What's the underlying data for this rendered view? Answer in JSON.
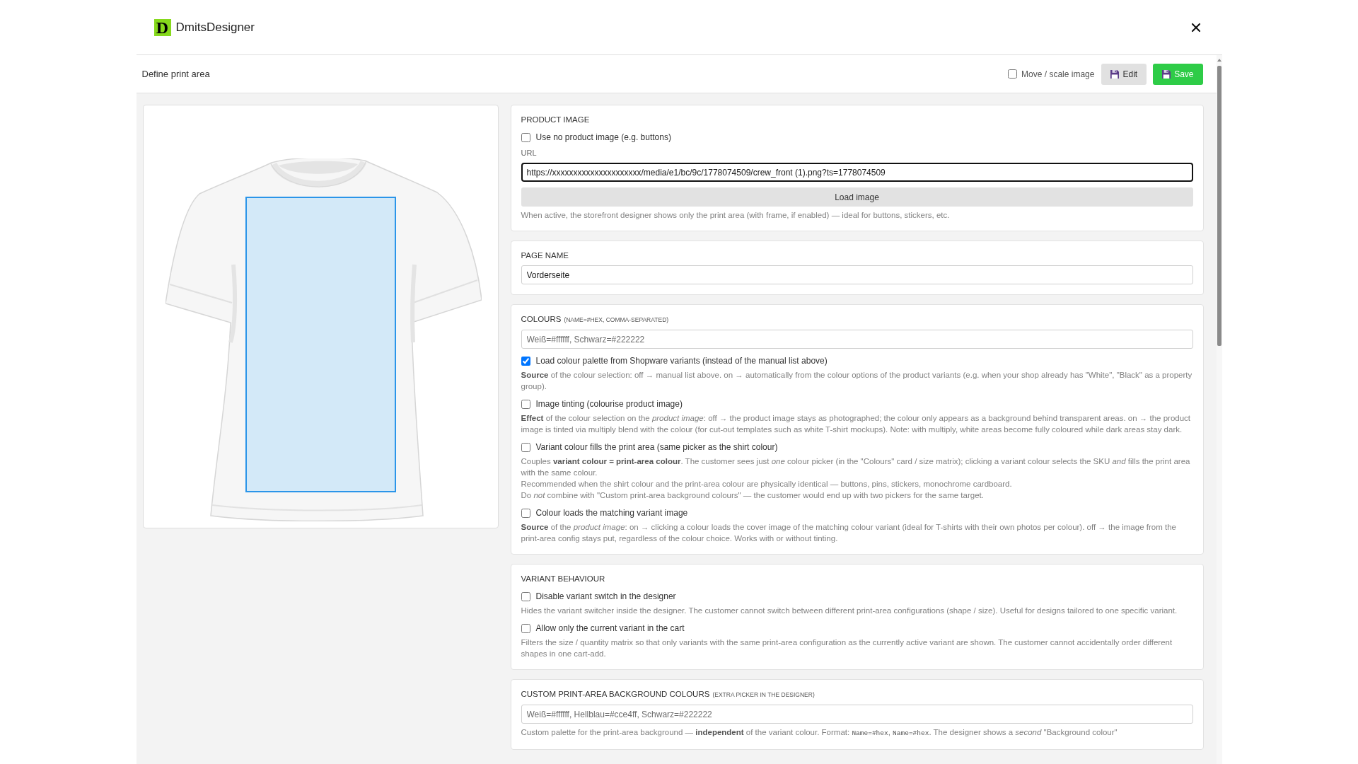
{
  "header": {
    "logo_letter": "D",
    "app_name": "DmitsDesigner"
  },
  "toolbar": {
    "title": "Define print area",
    "move_scale": {
      "label": "Move / scale image",
      "checked": false
    },
    "buttons": [
      {
        "kind": "secondary",
        "label": "Edit"
      },
      {
        "kind": "primary",
        "label": "Save"
      }
    ]
  },
  "cards": [
    {
      "title": "PRODUCT IMAGE",
      "items": [
        {
          "kind": "checkbox",
          "label": "Use no product image (e.g. buttons)",
          "checked": false
        },
        {
          "kind": "label",
          "text": "URL"
        },
        {
          "kind": "input",
          "value": "https://xxxxxxxxxxxxxxxxxxxxx/media/e1/bc/9c/1778074509/crew_front (1).png?ts=1778074509",
          "focused": true
        },
        {
          "kind": "button",
          "label": "Load image"
        },
        {
          "kind": "hint",
          "paragraphs": [
            "When active, the storefront designer shows only the print area (with frame, if enabled) — ideal for buttons, stickers, etc."
          ]
        }
      ]
    },
    {
      "title": "PAGE NAME",
      "items": [
        {
          "kind": "input",
          "value": "Vorderseite",
          "focused": false
        }
      ]
    },
    {
      "title": "COLOURS",
      "note": "(NAME=#HEX, COMMA-SEPARATED)",
      "items": [
        {
          "kind": "input",
          "placeholder": "Weiß=#ffffff, Schwarz=#222222",
          "focused": false
        },
        {
          "kind": "checkbox",
          "label": "Load colour palette from Shopware variants (instead of the manual list above)",
          "checked": true
        },
        {
          "kind": "hint",
          "paragraphs": [
            "**Source** of the colour selection: off → manual list above. on → automatically from the colour options of the product variants (e.g. when your shop already has \"White\", \"Black\" as a property group)."
          ]
        },
        {
          "kind": "checkbox",
          "label": "Image tinting (colourise product image)",
          "checked": false
        },
        {
          "kind": "hint",
          "paragraphs": [
            "**Effect** of the colour selection on the *product image*: off → the product image stays as photographed; the colour only appears as a background behind transparent areas. on → the product image is tinted via multiply blend with the colour (for cut-out templates such as white T-shirt mockups). Note: with multiply, white areas become fully coloured while dark areas stay dark."
          ]
        },
        {
          "kind": "checkbox",
          "label": "Variant colour fills the print area (same picker as the shirt colour)",
          "checked": false
        },
        {
          "kind": "hint",
          "paragraphs": [
            "Couples **variant colour = print-area colour**. The customer sees just *one* colour picker (in the \"Colours\" card / size matrix); clicking a variant colour selects the SKU *and* fills the print area with the same colour.",
            "Recommended when the shirt colour and the print-area colour are physically identical — buttons, pins, stickers, monochrome cardboard.",
            "Do *not* combine with \"Custom print-area background colours\" — the customer would end up with two pickers for the same target."
          ]
        },
        {
          "kind": "checkbox",
          "label": "Colour loads the matching variant image",
          "checked": false
        },
        {
          "kind": "hint",
          "paragraphs": [
            "**Source** of the *product image*: on → clicking a colour loads the cover image of the matching colour variant (ideal for T-shirts with their own photos per colour). off → the image from the print-area config stays put, regardless of the colour choice. Works with or without tinting."
          ]
        }
      ]
    },
    {
      "title": "VARIANT BEHAVIOUR",
      "items": [
        {
          "kind": "checkbox",
          "label": "Disable variant switch in the designer",
          "checked": false
        },
        {
          "kind": "hint",
          "paragraphs": [
            "Hides the variant switcher inside the designer. The customer cannot switch between different print-area configurations (shape / size). Useful for designs tailored to one specific variant."
          ]
        },
        {
          "kind": "checkbox",
          "label": "Allow only the current variant in the cart",
          "checked": false
        },
        {
          "kind": "hint",
          "paragraphs": [
            "Filters the size / quantity matrix so that only variants with the same print-area configuration as the currently active variant are shown. The customer cannot accidentally order different shapes in one cart-add."
          ]
        }
      ]
    },
    {
      "title": "CUSTOM PRINT-AREA BACKGROUND COLOURS",
      "note": "(EXTRA PICKER IN THE DESIGNER)",
      "items": [
        {
          "kind": "input",
          "placeholder": "Weiß=#ffffff, Hellblau=#cce4ff, Schwarz=#222222",
          "focused": false
        },
        {
          "kind": "hint",
          "paragraphs": [
            {
              "segments": [
                {
                  "kind": "text",
                  "text": "Custom palette for the print-area background — **independent** of the variant colour. Format: "
                },
                {
                  "kind": "code",
                  "text": "Name=#hex"
                },
                {
                  "kind": "text",
                  "text": ", "
                },
                {
                  "kind": "code",
                  "text": "Name=#hex"
                },
                {
                  "kind": "text",
                  "text": ". The designer shows a *second* \"Background colour\""
                }
              ]
            }
          ]
        }
      ]
    }
  ]
}
